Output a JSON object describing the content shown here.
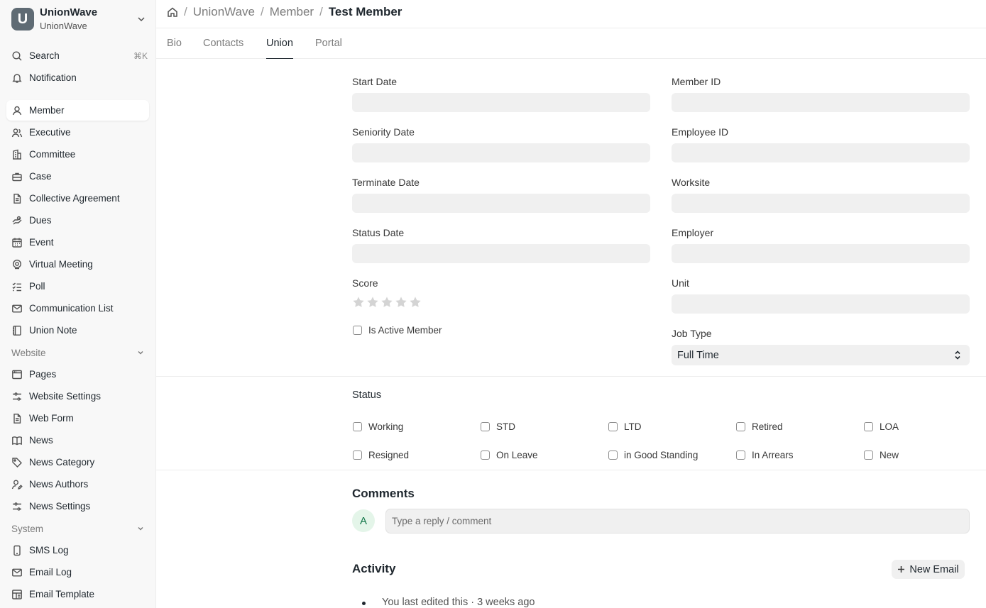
{
  "brand": {
    "logo_letter": "U",
    "title": "UnionWave",
    "subtitle": "UnionWave"
  },
  "sidebar": {
    "search_label": "Search",
    "search_shortcut": "⌘K",
    "notification_label": "Notification",
    "items": [
      {
        "label": "Member",
        "icon": "user-icon"
      },
      {
        "label": "Executive",
        "icon": "user-group-icon"
      },
      {
        "label": "Committee",
        "icon": "building-icon"
      },
      {
        "label": "Case",
        "icon": "briefcase-icon"
      },
      {
        "label": "Collective Agreement",
        "icon": "document-icon"
      },
      {
        "label": "Dues",
        "icon": "money-icon"
      },
      {
        "label": "Event",
        "icon": "calendar-icon"
      },
      {
        "label": "Virtual Meeting",
        "icon": "location-icon"
      },
      {
        "label": "Poll",
        "icon": "checklist-icon"
      },
      {
        "label": "Communication List",
        "icon": "mail-icon"
      },
      {
        "label": "Union Note",
        "icon": "notebook-icon"
      }
    ],
    "website_label": "Website",
    "website_items": [
      {
        "label": "Pages",
        "icon": "browser-icon"
      },
      {
        "label": "Website Settings",
        "icon": "sliders-icon"
      },
      {
        "label": "Web Form",
        "icon": "document-icon"
      },
      {
        "label": "News",
        "icon": "book-icon"
      },
      {
        "label": "News Category",
        "icon": "tag-icon"
      },
      {
        "label": "News Authors",
        "icon": "user-edit-icon"
      },
      {
        "label": "News Settings",
        "icon": "sliders-icon"
      }
    ],
    "system_label": "System",
    "system_items": [
      {
        "label": "SMS Log",
        "icon": "phone-icon"
      },
      {
        "label": "Email Log",
        "icon": "mail-icon"
      },
      {
        "label": "Email Template",
        "icon": "template-icon"
      }
    ]
  },
  "breadcrumb": {
    "items": [
      "UnionWave",
      "Member"
    ],
    "current": "Test Member",
    "separator": "/"
  },
  "tabs": [
    "Bio",
    "Contacts",
    "Union",
    "Portal"
  ],
  "form": {
    "left": [
      "Start Date",
      "Seniority Date",
      "Terminate Date",
      "Status Date"
    ],
    "score_label": "Score",
    "score_value": 0,
    "score_max": 5,
    "is_active_label": "Is Active Member",
    "right": [
      "Member ID",
      "Employee ID",
      "Worksite",
      "Employer",
      "Unit"
    ],
    "job_type_label": "Job Type",
    "job_type_value": "Full Time"
  },
  "status": {
    "title": "Status",
    "options": [
      "Working",
      "STD",
      "LTD",
      "Retired",
      "LOA",
      "Resigned",
      "On Leave",
      "in Good Standing",
      "In Arrears",
      "New"
    ]
  },
  "comments": {
    "title": "Comments",
    "avatar_letter": "A",
    "placeholder": "Type a reply / comment"
  },
  "activity": {
    "title": "Activity",
    "new_email_label": "New Email",
    "entry": "You last edited this · 3 weeks ago"
  },
  "colors": {
    "accent": "#1f272e",
    "input_bg": "#f0f0f0",
    "avatar_bg": "#e4f5e9",
    "avatar_fg": "#16794c"
  }
}
